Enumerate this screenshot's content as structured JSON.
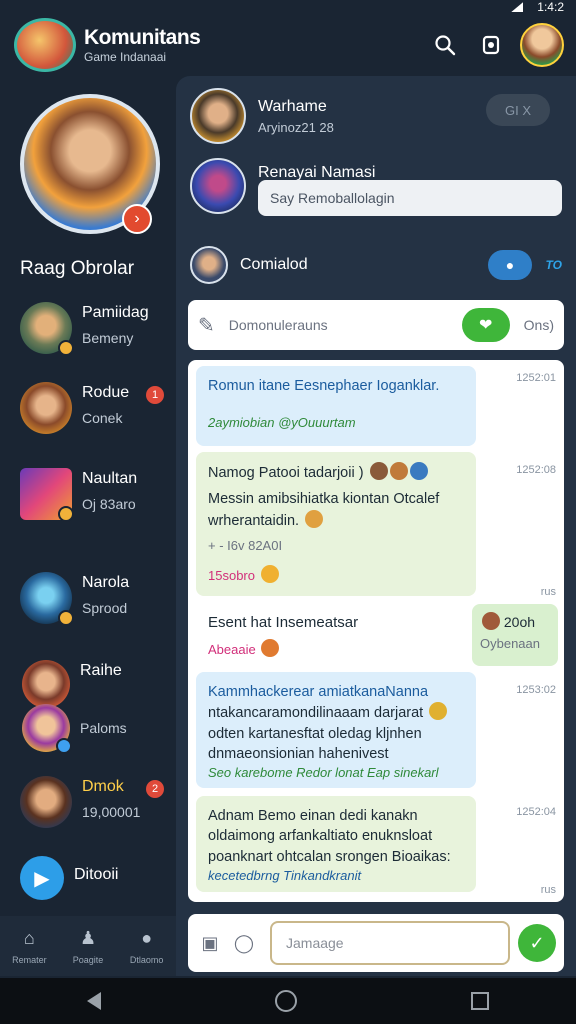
{
  "status_bar": {
    "time": "1:4:2"
  },
  "header": {
    "title": "Komunitans",
    "subtitle": "Game Indanaai"
  },
  "sidebar": {
    "section_title": "Raag Obrolar",
    "items": [
      {
        "name": "Pamiidag",
        "sub": "Bemeny"
      },
      {
        "name": "Rodue",
        "sub": "Conek",
        "badge": "1"
      },
      {
        "name": "Naultan",
        "sub": "Oj 83aro"
      },
      {
        "name": "Narola",
        "sub": "Sprood"
      },
      {
        "name": "Raihe",
        "sub": ""
      },
      {
        "name": "",
        "sub": "Paloms"
      },
      {
        "name": "Dmok",
        "sub": "19,00001",
        "badge": "2"
      },
      {
        "name": "Ditooii",
        "sub": ""
      }
    ],
    "tabs": [
      {
        "label": "Remater"
      },
      {
        "label": "Poagite"
      },
      {
        "label": "Dtlaomo"
      }
    ]
  },
  "main": {
    "contact1": {
      "name": "Warhame",
      "sub": "Aryinoz21 28",
      "close_label": "GI X"
    },
    "contact2": {
      "name": "Renayai Namasi",
      "input_value": "Say Remoballolagin"
    },
    "contact3": {
      "name": "Comialod",
      "toggle_label": "TO"
    },
    "search": {
      "placeholder": "Domonulerauns",
      "tail": "Ons)"
    },
    "messages": [
      {
        "text": "Romun itane Eesnephaer Ioganklar.",
        "sub": "2aymiobian @yOuuurtam",
        "time": "1252:01"
      },
      {
        "text": "Namog Patooi tadarjoii )",
        "line2": "Messin amibsihiatka kiontan Otcalef",
        "line3": "wrherantaidin.",
        "meta": "+ - I6v 82A0I",
        "tag": "15sobro",
        "time": "1252:08"
      },
      {
        "text": "Esent hat Insemeatsar",
        "sub": "Abeaaie",
        "reply_title": "20oh",
        "reply_sub": "Oybenaan",
        "time_small": "rus"
      },
      {
        "text": "Kammhackerear amiatkanaNanna",
        "line2": "ntakancaramondilinaaam darjarat",
        "line3": "odten kartanesftat oledag kljnhen",
        "line4": "dnmaeonsionian hahenivest",
        "sub": "Seo karebome Redor lonat Eap sinekarl",
        "time": "1253:02"
      },
      {
        "text": "Adnam Bemo einan dedi kanakn",
        "line2": "oldaimong arfankaltiato enuknsloat",
        "line3": "poanknart ohtcalan srongen Bioaikas:",
        "sub": "kecetedbrng Tinkandkranit",
        "time": "1252:04",
        "time_small": "rus"
      }
    ],
    "composer": {
      "placeholder": "Jamaage"
    }
  }
}
